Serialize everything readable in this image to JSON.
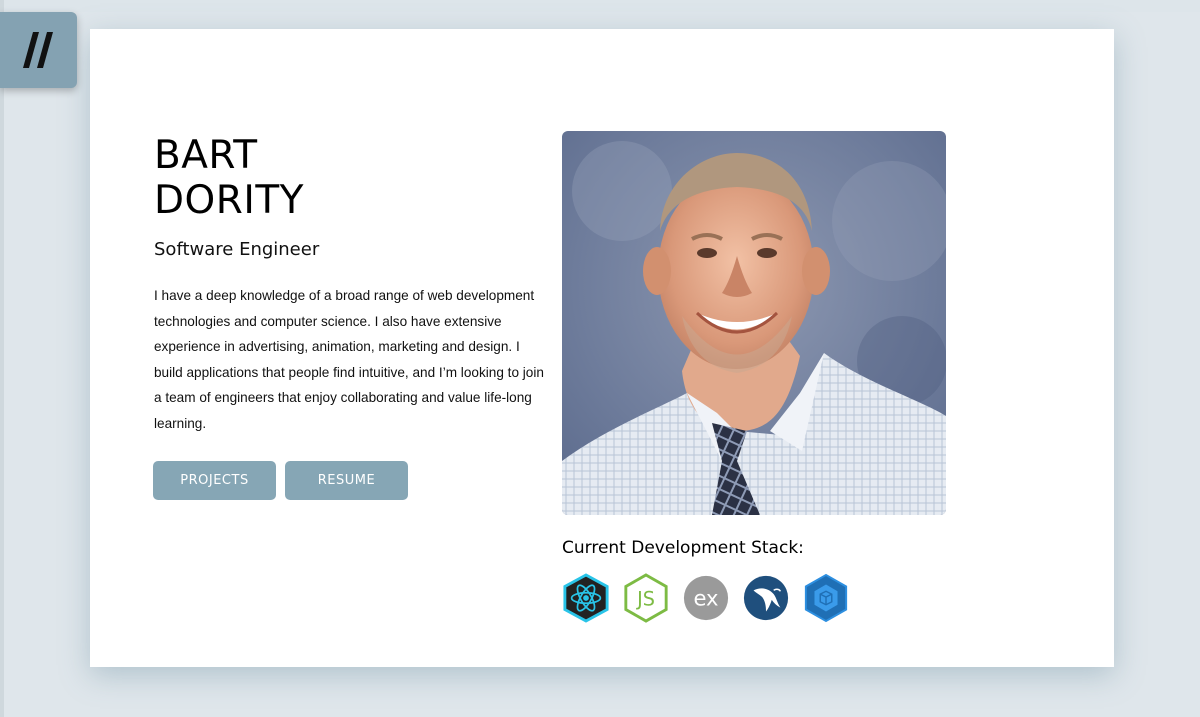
{
  "menu": {
    "icon": "double-slash-menu-icon"
  },
  "hero": {
    "first_name": "BART",
    "last_name": "DORITY",
    "role": "Software Engineer",
    "bio": "I have a deep knowledge of a broad range of web development technologies and computer science. I also have extensive experience in advertising, animation, marketing and design. I build applications that people find intuitive, and I’m looking to join a team of engineers that enjoy collaborating and value life-long learning.",
    "buttons": {
      "projects": "PROJECTS",
      "resume": "RESUME"
    }
  },
  "stack": {
    "title": "Current Development Stack:",
    "icons": [
      {
        "name": "react-icon",
        "label": ""
      },
      {
        "name": "nodejs-icon",
        "label": "JS"
      },
      {
        "name": "express-icon",
        "label": "ex"
      },
      {
        "name": "mysql-icon",
        "label": ""
      },
      {
        "name": "sequelize-icon",
        "label": ""
      }
    ]
  },
  "colors": {
    "accent": "#86a6b5",
    "background": "#dfe6eb",
    "card": "#ffffff"
  }
}
